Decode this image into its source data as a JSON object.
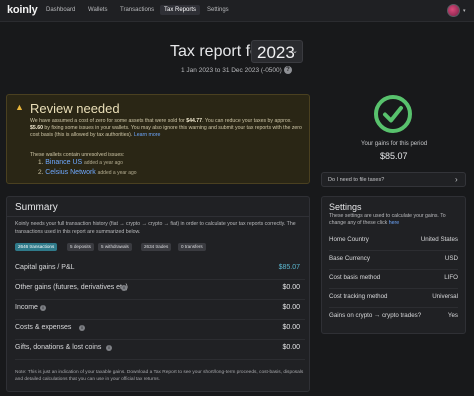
{
  "topbar": {
    "logo": "koinly",
    "nav": [
      {
        "label": "Dashboard",
        "active": false
      },
      {
        "label": "Wallets",
        "active": false
      },
      {
        "label": "Transactions",
        "active": false
      },
      {
        "label": "Tax Reports",
        "active": true
      },
      {
        "label": "Settings",
        "active": false
      }
    ],
    "avatar_icon": "user-avatar-icon",
    "avatar_caret": "▾"
  },
  "header": {
    "title": "Tax report for",
    "year": "2023",
    "year_caret": "⌄",
    "period": "1 Jan 2023 to 31 Dec 2023 (-0500)",
    "info_icon": "?"
  },
  "review": {
    "icon": "▲",
    "title": "Review needed",
    "text_part1": "We have assumed a cost of zero for some assets that were sold for ",
    "amount1": "$44.77",
    "text_part2": ". You can reduce your taxes by approx. ",
    "amount2": "$5.60",
    "text_part3": " by fixing some issues in your wallets. You may also ignore this warning and submit your tax reports with the zero cost basis (this is allowed by tax authorities).",
    "link": "Learn more",
    "wallets_intro": "These wallets contain unresolved issues:",
    "wallets": [
      {
        "num": "1.",
        "name": "Binance US",
        "meta": "added a year ago"
      },
      {
        "num": "2.",
        "name": "Celsius Network",
        "meta": "added a year ago"
      }
    ]
  },
  "gains": {
    "label": "Your gains for this period",
    "value": "$85.07",
    "accent": "#58c26d"
  },
  "file_taxes": {
    "label": "Do I need to file taxes?",
    "chevron": "›"
  },
  "summary": {
    "title": "Summary",
    "description": "Koinly needs your full transaction history (fiat → crypto → crypto → fiat) in order to calculate your tax reports correctly. The transactions used in this report are summarized below.",
    "chips": [
      {
        "label": "2646 transactions",
        "primary": true
      },
      {
        "label": "5 deposits",
        "primary": false
      },
      {
        "label": "5 withdrawals",
        "primary": false
      },
      {
        "label": "2634 trades",
        "primary": false
      },
      {
        "label": "0 transfers",
        "primary": false
      }
    ],
    "rows": [
      {
        "label": "Capital gains / P&L",
        "value": "$85.07",
        "accent": true
      },
      {
        "label": "Other gains (futures, derivatives etc)",
        "value": "$0.00",
        "accent": false
      },
      {
        "label": "Income",
        "value": "$0.00",
        "accent": false
      },
      {
        "label": "Costs & expenses",
        "value": "$0.00",
        "accent": false
      },
      {
        "label": "Gifts, donations & lost coins",
        "value": "$0.00",
        "accent": false
      }
    ],
    "info_icon": "i",
    "note": "Note: This is just an indication of your taxable gains. Download a Tax Report to see your short/long-term proceeds, cost-basis, disposals and detailed calculations that you can use in your official tax returns."
  },
  "settings": {
    "title": "Settings",
    "desc": "These settings are used to calculate your gains. To change any of these click ",
    "link": "here",
    "rows": [
      {
        "label": "Home Country",
        "value": "United States"
      },
      {
        "label": "Base Currency",
        "value": "USD"
      },
      {
        "label": "Cost basis method",
        "value": "LIFO"
      },
      {
        "label": "Cost tracking method",
        "value": "Universal"
      },
      {
        "label": "Gains on crypto → crypto trades?",
        "value": "Yes"
      }
    ]
  }
}
